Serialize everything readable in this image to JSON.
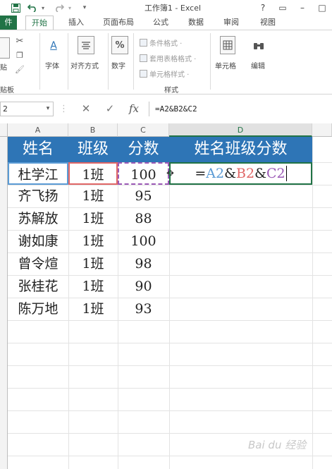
{
  "window": {
    "title": "工作簿1 - Excel",
    "help": "?",
    "restore": "▭",
    "minimize": "–",
    "maximize": "□"
  },
  "tabs": [
    {
      "label": "件",
      "kind": "file"
    },
    {
      "label": "开始",
      "kind": "active"
    },
    {
      "label": "插入",
      "kind": "normal"
    },
    {
      "label": "页面布局",
      "kind": "normal"
    },
    {
      "label": "公式",
      "kind": "normal"
    },
    {
      "label": "数据",
      "kind": "normal"
    },
    {
      "label": "审阅",
      "kind": "normal"
    },
    {
      "label": "视图",
      "kind": "normal"
    }
  ],
  "ribbon": {
    "paste_label": "贴",
    "clipboard_group": "贴板",
    "font_label": "字体",
    "align_label": "对齐方式",
    "number_label": "数字",
    "cond_format": "条件格式 ·",
    "table_format": "套用表格格式 ·",
    "cell_style": "单元格样式 ·",
    "styles_group": "样式",
    "cells_label": "单元格",
    "edit_label": "编辑",
    "font_icon_text": "A",
    "number_icon_text": "%"
  },
  "formula_bar": {
    "name_box": "2",
    "formula": "=A2&B2&C2",
    "fx": "fx",
    "cancel": "✕",
    "enter": "✓"
  },
  "grid": {
    "columns": [
      "A",
      "B",
      "C",
      "D"
    ],
    "header_row": [
      "姓名",
      "班级",
      "分数",
      "姓名班级分数"
    ],
    "rows": [
      {
        "name": "杜学江",
        "class": "1班",
        "score": "100"
      },
      {
        "name": "齐飞扬",
        "class": "1班",
        "score": "95"
      },
      {
        "name": "苏解放",
        "class": "1班",
        "score": "88"
      },
      {
        "name": "谢如康",
        "class": "1班",
        "score": "100"
      },
      {
        "name": "曾令煊",
        "class": "1班",
        "score": "98"
      },
      {
        "name": "张桂花",
        "class": "1班",
        "score": "90"
      },
      {
        "name": "陈万地",
        "class": "1班",
        "score": "93"
      }
    ],
    "editing_formula": {
      "eq": "=",
      "a": "A2",
      "amp1": "&",
      "b": "B2",
      "amp2": "&",
      "c": "C2"
    }
  },
  "colors": {
    "accent": "#217346",
    "header_fill": "#2e75b6",
    "ref_a": "#5b9bd5",
    "ref_b": "#e06666",
    "ref_c": "#9b59b6"
  },
  "watermark": "Bai du 经验"
}
